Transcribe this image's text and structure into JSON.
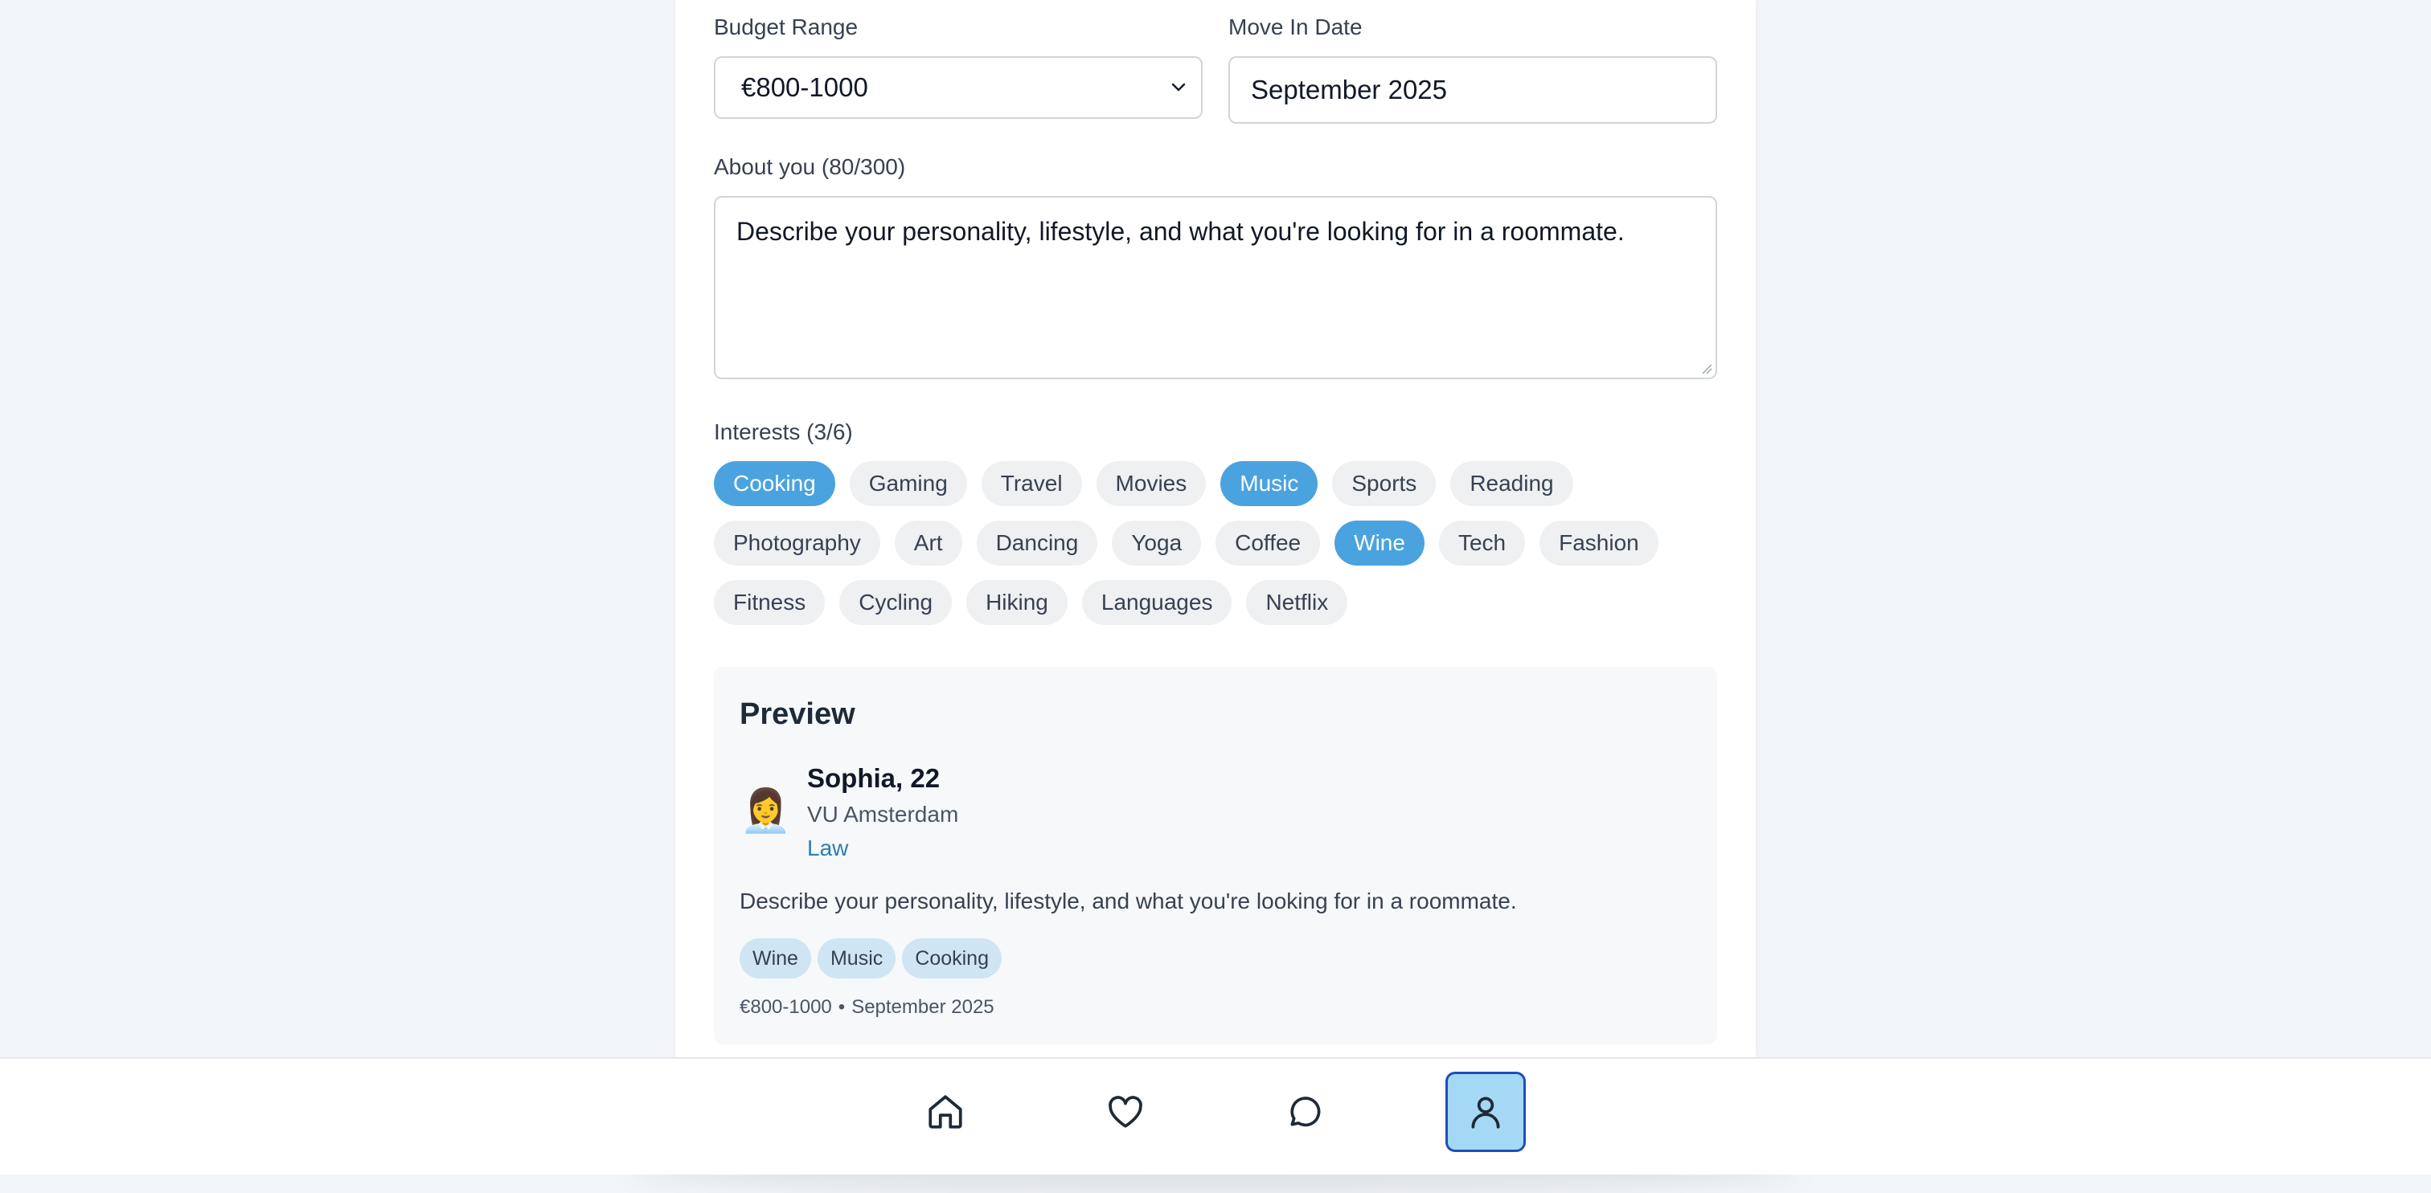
{
  "form": {
    "budget": {
      "label": "Budget Range",
      "value": "€800-1000"
    },
    "move_in": {
      "label": "Move In Date",
      "value": "September 2025"
    },
    "about": {
      "label": "About you (80/300)",
      "value": "Describe your personality, lifestyle, and what you're looking for in a roommate."
    },
    "interests": {
      "label": "Interests (3/6)",
      "rows": [
        [
          {
            "label": "Cooking",
            "selected": true
          },
          {
            "label": "Gaming",
            "selected": false
          },
          {
            "label": "Travel",
            "selected": false
          },
          {
            "label": "Movies",
            "selected": false
          },
          {
            "label": "Music",
            "selected": true
          },
          {
            "label": "Sports",
            "selected": false
          },
          {
            "label": "Reading",
            "selected": false
          }
        ],
        [
          {
            "label": "Photography",
            "selected": false
          },
          {
            "label": "Art",
            "selected": false
          },
          {
            "label": "Dancing",
            "selected": false
          },
          {
            "label": "Yoga",
            "selected": false
          },
          {
            "label": "Coffee",
            "selected": false
          },
          {
            "label": "Wine",
            "selected": true
          },
          {
            "label": "Tech",
            "selected": false
          },
          {
            "label": "Fashion",
            "selected": false
          }
        ],
        [
          {
            "label": "Fitness",
            "selected": false
          },
          {
            "label": "Cycling",
            "selected": false
          },
          {
            "label": "Hiking",
            "selected": false
          },
          {
            "label": "Languages",
            "selected": false
          },
          {
            "label": "Netflix",
            "selected": false
          }
        ]
      ]
    }
  },
  "preview": {
    "title": "Preview",
    "avatar": "👩‍💼",
    "name": "Sophia, 22",
    "university": "VU Amsterdam",
    "field": "Law",
    "about": "Describe your personality, lifestyle, and what you're looking for in a roommate.",
    "tags": [
      "Wine",
      "Music",
      "Cooking"
    ],
    "budget": "€800-1000",
    "separator": "•",
    "move_in": "September 2025"
  },
  "nav": {
    "items": [
      {
        "icon": "home-icon",
        "active": false
      },
      {
        "icon": "heart-icon",
        "active": false
      },
      {
        "icon": "chat-icon",
        "active": false
      },
      {
        "icon": "user-icon",
        "active": true
      }
    ],
    "accent": "#1d4fb8"
  },
  "colors": {
    "chip_selected": "#4aa3df",
    "link": "#2e7db3"
  }
}
